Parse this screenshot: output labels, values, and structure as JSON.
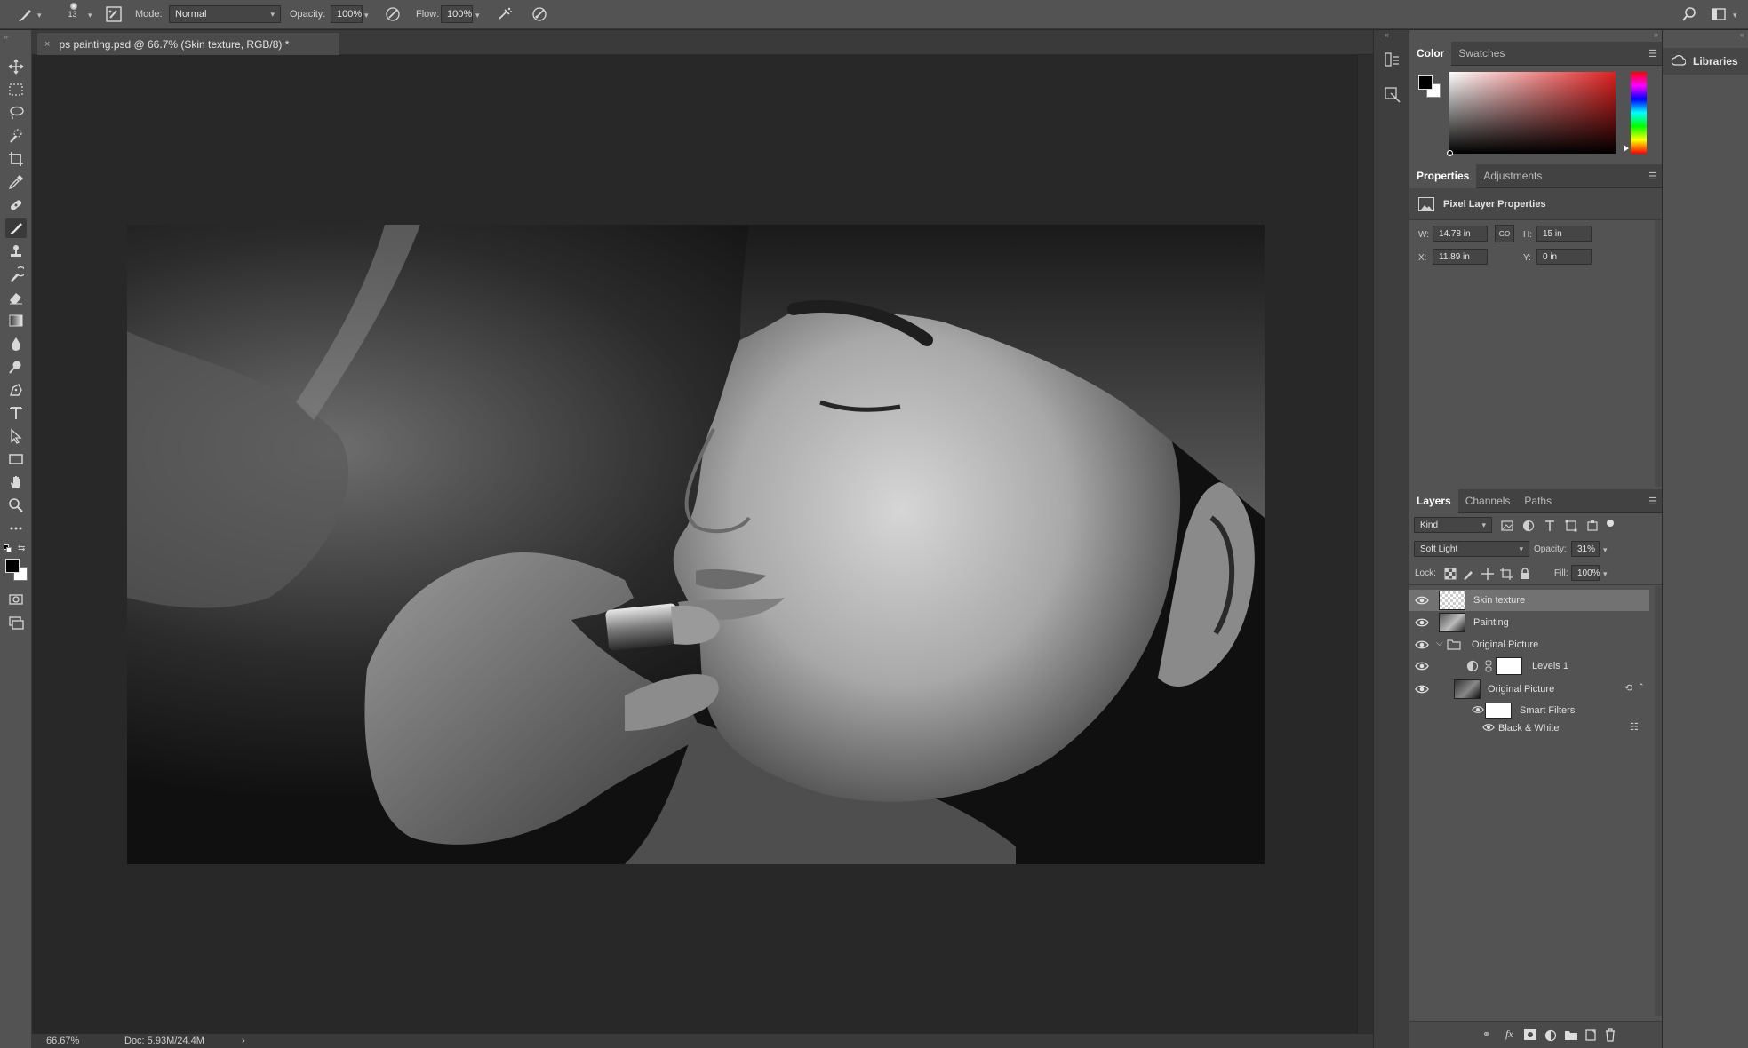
{
  "options_bar": {
    "brush_size": "13",
    "mode_label": "Mode:",
    "mode_value": "Normal",
    "opacity_label": "Opacity:",
    "opacity_value": "100%",
    "flow_label": "Flow:",
    "flow_value": "100%"
  },
  "document_tab": {
    "close_glyph": "×",
    "title": "ps painting.psd @ 66.7% (Skin texture, RGB/8) *"
  },
  "status_bar": {
    "zoom": "66.67%",
    "doc_size": "Doc: 5.93M/24.4M",
    "arrow": "›"
  },
  "color_panel": {
    "tabs": [
      "Color",
      "Swatches"
    ],
    "foreground": "#000000",
    "background": "#ffffff",
    "hue": "#e02020"
  },
  "properties_panel": {
    "tabs": [
      "Properties",
      "Adjustments"
    ],
    "header": "Pixel Layer Properties",
    "w_label": "W:",
    "w_value": "14.78 in",
    "h_label": "H:",
    "h_value": "15 in",
    "x_label": "X:",
    "x_value": "11.89 in",
    "y_label": "Y:",
    "y_value": "0 in",
    "link_label": "GO"
  },
  "layers_panel": {
    "tabs": [
      "Layers",
      "Channels",
      "Paths"
    ],
    "filter_value": "Kind",
    "blend_mode": "Soft Light",
    "opacity_label": "Opacity:",
    "opacity_value": "31%",
    "lock_label": "Lock:",
    "fill_label": "Fill:",
    "fill_value": "100%",
    "layers": [
      {
        "name": "Skin texture",
        "selected": true
      },
      {
        "name": "Painting",
        "selected": false
      },
      {
        "name": "Original Picture",
        "selected": false,
        "type": "group"
      },
      {
        "name": "Levels 1",
        "selected": false,
        "type": "adjustment"
      },
      {
        "name": "Original Picture",
        "selected": false,
        "type": "smart-object"
      },
      {
        "name": "Smart Filters",
        "selected": false,
        "type": "filter-mask"
      },
      {
        "name": "Black & White",
        "selected": false,
        "type": "filter"
      }
    ]
  },
  "libraries_panel": {
    "label": "Libraries"
  }
}
